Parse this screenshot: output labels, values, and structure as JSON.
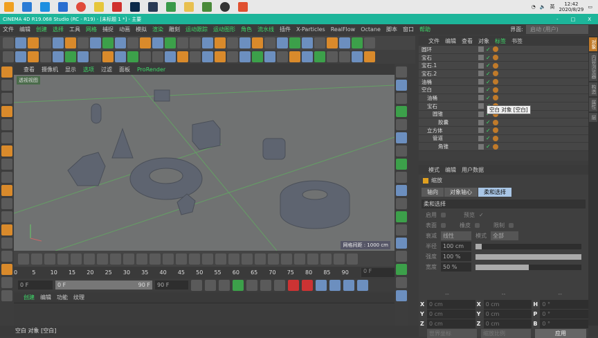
{
  "taskbar": {
    "time": "12:42",
    "date": "2020/8/29",
    "ime": "英"
  },
  "window": {
    "title": "CINEMA 4D R19.068 Studio (RC - R19) - [未标题 1 *] - 主要",
    "min": "-",
    "max": "□",
    "close": "X"
  },
  "menu": {
    "items": [
      {
        "label": "文件",
        "g": false
      },
      {
        "label": "编辑",
        "g": false
      },
      {
        "label": "创建",
        "g": true
      },
      {
        "label": "选择",
        "g": true
      },
      {
        "label": "工具",
        "g": false
      },
      {
        "label": "网格",
        "g": true
      },
      {
        "label": "捕捉",
        "g": false
      },
      {
        "label": "动画",
        "g": false
      },
      {
        "label": "模拟",
        "g": false
      },
      {
        "label": "渲染",
        "g": true
      },
      {
        "label": "雕刻",
        "g": false
      },
      {
        "label": "运动跟踪",
        "g": true
      },
      {
        "label": "运动图形",
        "g": true
      },
      {
        "label": "角色",
        "g": true
      },
      {
        "label": "流水线",
        "g": true
      },
      {
        "label": "插件",
        "g": false
      },
      {
        "label": "X-Particles",
        "g": false
      },
      {
        "label": "RealFlow",
        "g": false
      },
      {
        "label": "Octane",
        "g": false
      },
      {
        "label": "脚本",
        "g": false
      },
      {
        "label": "窗口",
        "g": false
      },
      {
        "label": "帮助",
        "g": true
      }
    ],
    "layout_label": "界面:",
    "layout_value": "启动 (用户)"
  },
  "viewport": {
    "menu": [
      "查看",
      "摄像机",
      "显示",
      "选项",
      "过滤",
      "面板",
      "ProRender"
    ],
    "active": [
      3,
      6
    ],
    "label": "透视视图",
    "grid": "网格间距 : 1000 cm"
  },
  "timeline": {
    "ticks": [
      "0",
      "5",
      "10",
      "15",
      "20",
      "25",
      "30",
      "35",
      "40",
      "45",
      "50",
      "55",
      "60",
      "65",
      "70",
      "75",
      "80",
      "85",
      "90"
    ],
    "frame_end": "0 F",
    "start": "0 F",
    "range_start": "0 F",
    "range_end": "90 F",
    "end": "90 F"
  },
  "material": {
    "menu": [
      "创建",
      "编辑",
      "功能",
      "纹理"
    ]
  },
  "status": "空白 对象 [空白]",
  "objects": {
    "menu": [
      "文件",
      "编辑",
      "查看",
      "对象",
      "标签",
      "书签"
    ],
    "rows": [
      {
        "name": "圆环",
        "d": 0
      },
      {
        "name": "宝石",
        "d": 0
      },
      {
        "name": "宝石.1",
        "d": 0
      },
      {
        "name": "宝石.2",
        "d": 0
      },
      {
        "name": "油桶",
        "d": 0
      },
      {
        "name": "空白",
        "d": 0
      },
      {
        "name": "油桶",
        "d": 1
      },
      {
        "name": "宝石",
        "d": 1
      },
      {
        "name": "圆锥",
        "d": 2
      },
      {
        "name": "胶囊",
        "d": 3
      },
      {
        "name": "立方体",
        "d": 1
      },
      {
        "name": "管道",
        "d": 2
      },
      {
        "name": "角锥",
        "d": 3
      }
    ],
    "tooltip": "空白 对象 [空白]"
  },
  "attributes": {
    "menu": [
      "模式",
      "编辑",
      "用户数据"
    ],
    "object": "缩放",
    "tabs": [
      "轴向",
      "对象轴心",
      "柔和选择"
    ],
    "section": "柔和选择",
    "apply": "启用",
    "preview": "预览",
    "preview_check": "✓",
    "surface": "表面",
    "rubber": "橡皮",
    "restrict": "限制",
    "falloff_label": "衰减",
    "falloff": "线性",
    "mode_label": "模式",
    "mode": "全部",
    "radius_label": "半径",
    "radius": "100 cm",
    "radius_frac": 0.06,
    "strength_label": "强度",
    "strength": "100 %",
    "strength_frac": 1.0,
    "width_label": "宽度",
    "width": "50 %",
    "width_frac": 0.5
  },
  "coords": {
    "dash": "--",
    "rows": [
      [
        "X",
        "0 cm",
        "X",
        "0 cm",
        "H",
        "0 °"
      ],
      [
        "Y",
        "0 cm",
        "Y",
        "0 cm",
        "P",
        "0 °"
      ],
      [
        "Z",
        "0 cm",
        "Z",
        "0 cm",
        "B",
        "0 °"
      ]
    ],
    "world": "世界坐标",
    "scale": "缩放比例",
    "apply": "应用"
  },
  "sidetabs": [
    "对象",
    "内容浏览器",
    "构造",
    "属性",
    "层"
  ]
}
